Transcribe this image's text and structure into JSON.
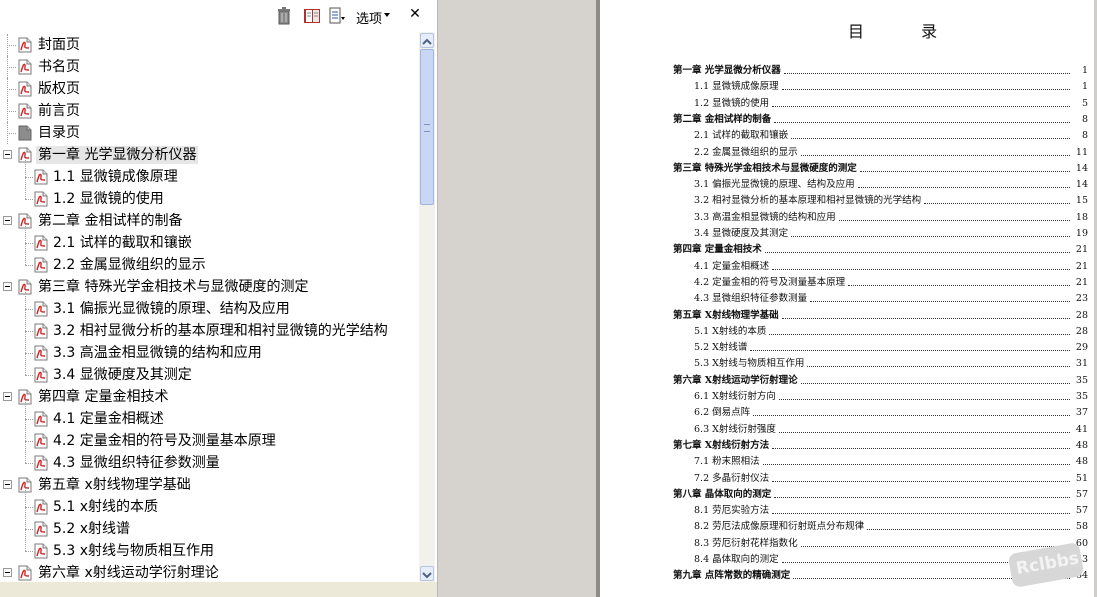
{
  "toolbar": {
    "options_label": "选项",
    "icons": [
      "trash-icon",
      "book-icon",
      "properties-icon"
    ],
    "close_glyph": "✕"
  },
  "bookmarks": [
    {
      "label": "封面页",
      "level": 0,
      "icon": "pdf-page-icon"
    },
    {
      "label": "书名页",
      "level": 0,
      "icon": "pdf-page-icon"
    },
    {
      "label": "版权页",
      "level": 0,
      "icon": "pdf-page-icon"
    },
    {
      "label": "前言页",
      "level": 0,
      "icon": "pdf-page-icon"
    },
    {
      "label": "目录页",
      "level": 0,
      "icon": "gray-page-icon"
    },
    {
      "label": "第一章  光学显微分析仪器",
      "level": 0,
      "icon": "pdf-page-icon",
      "expanded": true,
      "selected": true
    },
    {
      "label": "1.1  显微镜成像原理",
      "level": 1,
      "icon": "pdf-page-icon"
    },
    {
      "label": "1.2  显微镜的使用",
      "level": 1,
      "icon": "pdf-page-icon"
    },
    {
      "label": "第二章  金相试样的制备",
      "level": 0,
      "icon": "pdf-page-icon",
      "expanded": true
    },
    {
      "label": "2.1  试样的截取和镶嵌",
      "level": 1,
      "icon": "pdf-page-icon"
    },
    {
      "label": "2.2  金属显微组织的显示",
      "level": 1,
      "icon": "pdf-page-icon"
    },
    {
      "label": "第三章  特殊光学金相技术与显微硬度的测定",
      "level": 0,
      "icon": "pdf-page-icon",
      "expanded": true
    },
    {
      "label": "3.1  偏振光显微镜的原理、结构及应用",
      "level": 1,
      "icon": "pdf-page-icon"
    },
    {
      "label": "3.2  相衬显微分析的基本原理和相衬显微镜的光学结构",
      "level": 1,
      "icon": "pdf-page-icon"
    },
    {
      "label": "3.3  高温金相显微镜的结构和应用",
      "level": 1,
      "icon": "pdf-page-icon"
    },
    {
      "label": "3.4  显微硬度及其测定",
      "level": 1,
      "icon": "pdf-page-icon"
    },
    {
      "label": "第四章  定量金相技术",
      "level": 0,
      "icon": "pdf-page-icon",
      "expanded": true
    },
    {
      "label": "4.1  定量金相概述",
      "level": 1,
      "icon": "pdf-page-icon"
    },
    {
      "label": "4.2  定量金相的符号及测量基本原理",
      "level": 1,
      "icon": "pdf-page-icon"
    },
    {
      "label": "4.3  显微组织特征参数测量",
      "level": 1,
      "icon": "pdf-page-icon"
    },
    {
      "label": "第五章  x射线物理学基础",
      "level": 0,
      "icon": "pdf-page-icon",
      "expanded": true
    },
    {
      "label": "5.1  x射线的本质",
      "level": 1,
      "icon": "pdf-page-icon"
    },
    {
      "label": "5.2  x射线谱",
      "level": 1,
      "icon": "pdf-page-icon"
    },
    {
      "label": "5.3  x射线与物质相互作用",
      "level": 1,
      "icon": "pdf-page-icon"
    },
    {
      "label": "第六章  x射线运动学衍射理论",
      "level": 0,
      "icon": "pdf-page-icon",
      "expanded": true
    }
  ],
  "document": {
    "title": "目 录",
    "toc": [
      {
        "label": "第一章  光学显微分析仪器",
        "page": "1",
        "chapter": true
      },
      {
        "label": "1.1   显微镜成像原理",
        "page": "1",
        "chapter": false
      },
      {
        "label": "1.2   显微镜的使用",
        "page": "5",
        "chapter": false
      },
      {
        "label": "第二章  金相试样的制备",
        "page": "8",
        "chapter": true
      },
      {
        "label": "2.1   试样的截取和镶嵌",
        "page": "8",
        "chapter": false
      },
      {
        "label": "2.2   金属显微组织的显示",
        "page": "11",
        "chapter": false
      },
      {
        "label": "第三章  特殊光学金相技术与显微硬度的测定",
        "page": "14",
        "chapter": true
      },
      {
        "label": "3.1   偏振光显微镜的原理、结构及应用",
        "page": "14",
        "chapter": false
      },
      {
        "label": "3.2   相衬显微分析的基本原理和相衬显微镜的光学结构",
        "page": "15",
        "chapter": false
      },
      {
        "label": "3.3   高温金相显微镜的结构和应用",
        "page": "18",
        "chapter": false
      },
      {
        "label": "3.4   显微硬度及其测定",
        "page": "19",
        "chapter": false
      },
      {
        "label": "第四章  定量金相技术",
        "page": "21",
        "chapter": true
      },
      {
        "label": "4.1   定量金相概述",
        "page": "21",
        "chapter": false
      },
      {
        "label": "4.2   定量金相的符号及测量基本原理",
        "page": "21",
        "chapter": false
      },
      {
        "label": "4.3   显微组织特征参数测量",
        "page": "23",
        "chapter": false
      },
      {
        "label": "第五章  X射线物理学基础",
        "page": "28",
        "chapter": true
      },
      {
        "label": "5.1   X射线的本质",
        "page": "28",
        "chapter": false
      },
      {
        "label": "5.2   X射线谱",
        "page": "29",
        "chapter": false
      },
      {
        "label": "5.3   X射线与物质相互作用",
        "page": "31",
        "chapter": false
      },
      {
        "label": "第六章  X射线运动学衍射理论",
        "page": "35",
        "chapter": true
      },
      {
        "label": "6.1   X射线衍射方向",
        "page": "35",
        "chapter": false
      },
      {
        "label": "6.2   倒易点阵",
        "page": "37",
        "chapter": false
      },
      {
        "label": "6.3   X射线衍射强度",
        "page": "41",
        "chapter": false
      },
      {
        "label": "第七章  X射线衍射方法",
        "page": "48",
        "chapter": true
      },
      {
        "label": "7.1   粉末照相法",
        "page": "48",
        "chapter": false
      },
      {
        "label": "7.2   多晶衍射仪法",
        "page": "51",
        "chapter": false
      },
      {
        "label": "第八章  晶体取向的测定",
        "page": "57",
        "chapter": true
      },
      {
        "label": "8.1   劳厄实验方法",
        "page": "57",
        "chapter": false
      },
      {
        "label": "8.2   劳厄法成像原理和衍射斑点分布规律",
        "page": "58",
        "chapter": false
      },
      {
        "label": "8.3   劳厄衍射花样指数化",
        "page": "60",
        "chapter": false
      },
      {
        "label": "8.4   晶体取向的测定",
        "page": "63",
        "chapter": false
      },
      {
        "label": "第九章  点阵常数的精确测定",
        "page": "64",
        "chapter": true
      }
    ],
    "watermark": "Rclbbs"
  },
  "colors": {
    "pdf_red": "#d42020",
    "panel_bg": "#ffffff",
    "gutter": "#d6d3ce",
    "scrollbar_thumb": "#c8d7f3"
  }
}
